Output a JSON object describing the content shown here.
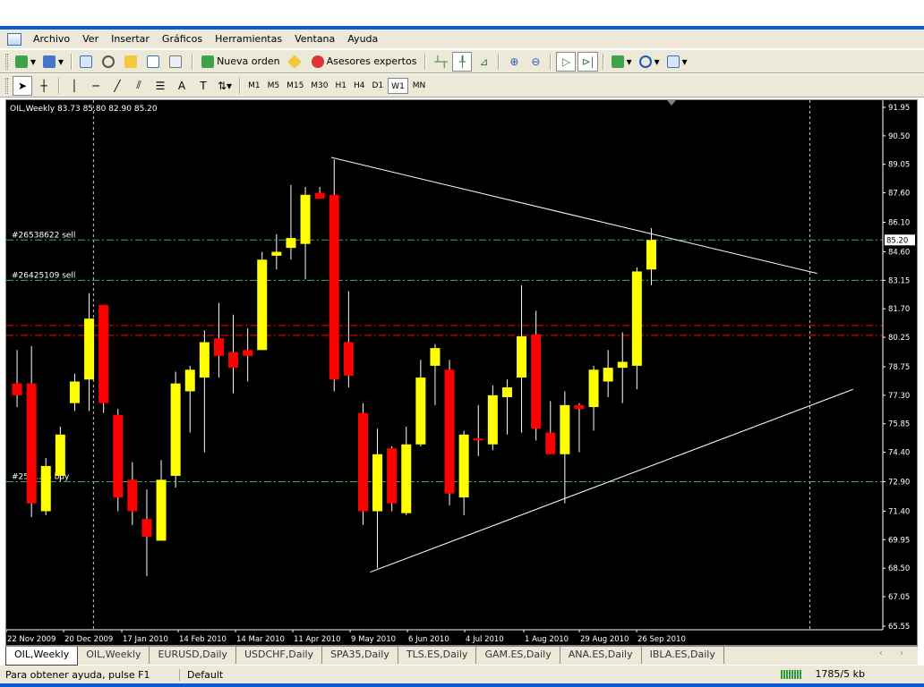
{
  "menu": [
    "Archivo",
    "Ver",
    "Insertar",
    "Gráficos",
    "Herramientas",
    "Ventana",
    "Ayuda"
  ],
  "window_controls": [
    "_",
    "❐",
    "✕"
  ],
  "toolbar": {
    "nueva_orden": "Nueva orden",
    "asesores": "Asesores expertos",
    "draw_labels": {
      "text": "A"
    }
  },
  "timeframes": [
    "M1",
    "M5",
    "M15",
    "M30",
    "H1",
    "H4",
    "D1",
    "W1",
    "MN"
  ],
  "active_timeframe": "W1",
  "chart_data": {
    "type": "candlestick",
    "symbol_header": "OIL,Weekly  83.73 85.80 82.90 85.20",
    "yticks": [
      "91.95",
      "90.50",
      "89.05",
      "87.60",
      "86.10",
      "84.60",
      "83.15",
      "81.70",
      "80.25",
      "78.75",
      "77.30",
      "75.85",
      "74.40",
      "72.90",
      "71.40",
      "69.95",
      "68.50",
      "67.05",
      "65.55"
    ],
    "ylim": [
      65.55,
      91.95
    ],
    "current_price": "85.20",
    "xticks": [
      "22 Nov 2009",
      "20 Dec 2009",
      "17 Jan 2010",
      "14 Feb 2010",
      "14 Mar 2010",
      "11 Apr 2010",
      "9 May 2010",
      "6 Jun 2010",
      "4 Jul 2010",
      "1 Aug 2010",
      "29 Aug 2010",
      "26 Sep 2010"
    ],
    "colors": {
      "bull": "#ffff00",
      "bear": "#ff0000",
      "background": "#000000",
      "grid_label": "#ffffff"
    },
    "candles": [
      {
        "o": 77.9,
        "h": 79.6,
        "l": 76.7,
        "c": 77.3
      },
      {
        "o": 77.9,
        "h": 79.8,
        "l": 71.1,
        "c": 71.8
      },
      {
        "o": 71.4,
        "h": 74.1,
        "l": 71.2,
        "c": 73.7
      },
      {
        "o": 73.2,
        "h": 75.7,
        "l": 72.9,
        "c": 75.3
      },
      {
        "o": 76.9,
        "h": 78.4,
        "l": 76.5,
        "c": 78.0
      },
      {
        "o": 78.1,
        "h": 82.5,
        "l": 76.5,
        "c": 81.2
      },
      {
        "o": 81.9,
        "h": 81.9,
        "l": 76.4,
        "c": 76.9
      },
      {
        "o": 76.3,
        "h": 76.6,
        "l": 71.4,
        "c": 72.1
      },
      {
        "o": 73.0,
        "h": 73.9,
        "l": 70.7,
        "c": 71.4
      },
      {
        "o": 71.0,
        "h": 72.5,
        "l": 68.1,
        "c": 70.1
      },
      {
        "o": 69.9,
        "h": 74.0,
        "l": 69.9,
        "c": 73.0
      },
      {
        "o": 73.2,
        "h": 78.5,
        "l": 72.6,
        "c": 77.9
      },
      {
        "o": 77.5,
        "h": 78.8,
        "l": 75.4,
        "c": 78.6
      },
      {
        "o": 78.2,
        "h": 80.6,
        "l": 74.4,
        "c": 80.0
      },
      {
        "o": 80.2,
        "h": 82.0,
        "l": 78.2,
        "c": 79.3
      },
      {
        "o": 79.5,
        "h": 81.4,
        "l": 77.4,
        "c": 78.7
      },
      {
        "o": 79.6,
        "h": 80.7,
        "l": 78.0,
        "c": 79.3
      },
      {
        "o": 79.6,
        "h": 84.6,
        "l": 79.6,
        "c": 84.2
      },
      {
        "o": 84.4,
        "h": 85.5,
        "l": 83.7,
        "c": 84.6
      },
      {
        "o": 84.8,
        "h": 88.0,
        "l": 84.2,
        "c": 85.3
      },
      {
        "o": 85.0,
        "h": 87.9,
        "l": 83.2,
        "c": 87.5
      },
      {
        "o": 87.6,
        "h": 87.9,
        "l": 87.3,
        "c": 87.3
      },
      {
        "o": 87.5,
        "h": 89.3,
        "l": 77.5,
        "c": 78.1
      },
      {
        "o": 80.0,
        "h": 82.6,
        "l": 77.7,
        "c": 78.3
      },
      {
        "o": 76.4,
        "h": 76.9,
        "l": 70.7,
        "c": 71.4
      },
      {
        "o": 71.4,
        "h": 75.6,
        "l": 68.5,
        "c": 74.3
      },
      {
        "o": 74.6,
        "h": 74.7,
        "l": 71.4,
        "c": 71.8
      },
      {
        "o": 71.3,
        "h": 75.7,
        "l": 71.2,
        "c": 74.8
      },
      {
        "o": 74.8,
        "h": 79.1,
        "l": 74.7,
        "c": 78.2
      },
      {
        "o": 78.8,
        "h": 79.9,
        "l": 76.8,
        "c": 79.7
      },
      {
        "o": 78.6,
        "h": 79.1,
        "l": 71.7,
        "c": 72.3
      },
      {
        "o": 72.1,
        "h": 75.5,
        "l": 71.2,
        "c": 75.3
      },
      {
        "o": 75.1,
        "h": 76.8,
        "l": 74.2,
        "c": 75.0
      },
      {
        "o": 74.8,
        "h": 77.8,
        "l": 74.5,
        "c": 77.3
      },
      {
        "o": 77.2,
        "h": 78.1,
        "l": 75.3,
        "c": 77.7
      },
      {
        "o": 78.2,
        "h": 82.9,
        "l": 75.4,
        "c": 80.3
      },
      {
        "o": 80.4,
        "h": 81.6,
        "l": 75.0,
        "c": 75.6
      },
      {
        "o": 75.4,
        "h": 77.0,
        "l": 74.3,
        "c": 74.3
      },
      {
        "o": 74.3,
        "h": 77.5,
        "l": 71.8,
        "c": 76.8
      },
      {
        "o": 76.8,
        "h": 76.9,
        "l": 74.4,
        "c": 76.6
      },
      {
        "o": 76.7,
        "h": 78.8,
        "l": 75.5,
        "c": 78.6
      },
      {
        "o": 78.0,
        "h": 79.6,
        "l": 77.2,
        "c": 78.7
      },
      {
        "o": 78.7,
        "h": 80.5,
        "l": 76.9,
        "c": 79.0
      },
      {
        "o": 78.8,
        "h": 83.8,
        "l": 77.6,
        "c": 83.6
      },
      {
        "o": 83.7,
        "h": 85.8,
        "l": 82.9,
        "c": 85.2
      }
    ],
    "hlines": [
      {
        "label": "#26538622 sell",
        "price": 85.2,
        "color": "#3cb44b"
      },
      {
        "label": "#26425109 sell",
        "price": 83.15,
        "color": "#3cb44b"
      },
      {
        "label": "#254...05 buy",
        "price": 72.9,
        "color": "#3cb44b"
      },
      {
        "label": "",
        "price": 80.85,
        "color": "#ff0000"
      },
      {
        "label": "",
        "price": 80.35,
        "color": "#ff0000"
      }
    ],
    "trendlines": [
      {
        "from": {
          "bar": 22.3,
          "price": 89.4
        },
        "to": {
          "bar": 56.0,
          "price": 83.5
        }
      },
      {
        "from": {
          "bar": 25.0,
          "price": 68.3
        },
        "to": {
          "bar": 58.5,
          "price": 77.6
        }
      }
    ],
    "vlines": [
      {
        "bar": 5.8
      },
      {
        "bar": 55.5
      }
    ]
  },
  "tabs": [
    "OIL,Weekly",
    "OIL,Weekly",
    "EURUSD,Daily",
    "USDCHF,Daily",
    "SPA35,Daily",
    "TLS.ES,Daily",
    "GAM.ES,Daily",
    "ANA.ES,Daily",
    "IBLA.ES,Daily"
  ],
  "tab_arrows": "‹ ›",
  "status": {
    "help": "Para obtener ayuda, pulse F1",
    "profile": "Default",
    "size": "1785/5 kb"
  }
}
